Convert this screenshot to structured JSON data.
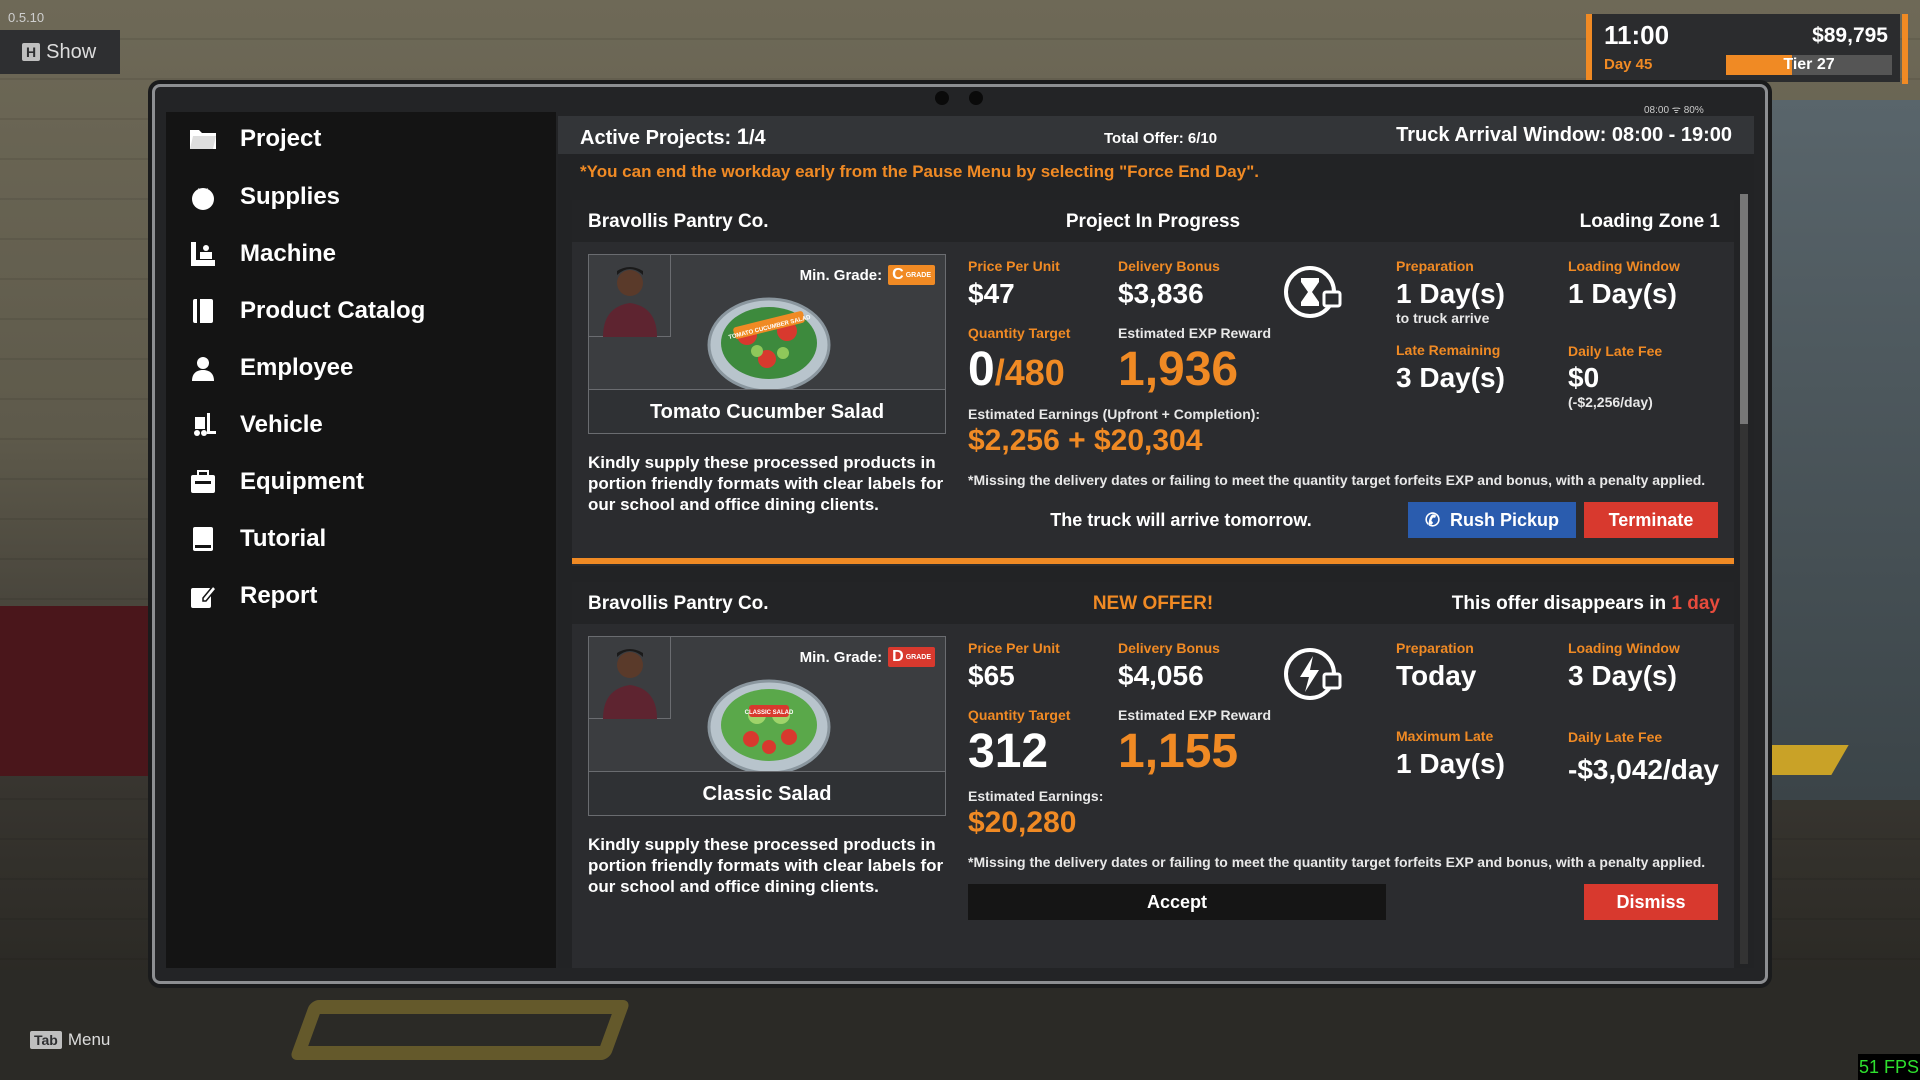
{
  "game": {
    "version": "0.5.10",
    "show_key": "H",
    "show_label": "Show",
    "menu_key": "Tab",
    "menu_label": "Menu",
    "fps": "51 FPS"
  },
  "hud": {
    "time": "11:00",
    "money": "$89,795",
    "day": "Day 45",
    "tier": "Tier 27",
    "tier_progress": 0.4
  },
  "tablet_status": "08:00  ᯤ  80%",
  "sidebar": {
    "items": [
      {
        "label": "Project",
        "icon": "folder-icon"
      },
      {
        "label": "Supplies",
        "icon": "tomato-icon"
      },
      {
        "label": "Machine",
        "icon": "machine-icon"
      },
      {
        "label": "Product Catalog",
        "icon": "catalog-icon"
      },
      {
        "label": "Employee",
        "icon": "employee-icon"
      },
      {
        "label": "Vehicle",
        "icon": "forklift-icon"
      },
      {
        "label": "Equipment",
        "icon": "equipment-icon"
      },
      {
        "label": "Tutorial",
        "icon": "book-icon"
      },
      {
        "label": "Report",
        "icon": "report-icon"
      }
    ]
  },
  "header": {
    "active_label": "Active Projects:",
    "active_value": "1",
    "active_total": "/4",
    "total_offer": "Total Offer: 6/10",
    "truck_window": "Truck Arrival Window: 08:00 - 19:00",
    "notice": "*You can end the workday early from the Pause Menu by selecting \"Force End Day\"."
  },
  "project": {
    "company": "Bravollis Pantry Co.",
    "status": "Project In Progress",
    "zone": "Loading Zone 1",
    "min_grade_label": "Min. Grade:",
    "grade": "C",
    "grade_word": "GRADE",
    "plate_text": "TOMATO CUCUMBER SALAD",
    "product": "Tomato Cucumber Salad",
    "description": "Kindly supply these processed products in portion friendly formats with clear labels for our school and office dining clients.",
    "price_label": "Price Per Unit",
    "price": "$47",
    "bonus_label": "Delivery Bonus",
    "bonus": "$3,836",
    "qty_label": "Quantity Target",
    "qty_done": "0",
    "qty_target": "/480",
    "exp_label": "Estimated EXP Reward",
    "exp": "1,936",
    "prep_label": "Preparation",
    "prep": "1 Day(s)",
    "prep_sub": "to truck arrive",
    "loading_label": "Loading Window",
    "loading": "1 Day(s)",
    "late_label": "Late Remaining",
    "late": "3 Day(s)",
    "fee_label": "Daily Late Fee",
    "fee": "$0",
    "fee_sub": "(-$2,256/day)",
    "earn_label": "Estimated Earnings (Upfront + Completion):",
    "earn": "$2,256 + $20,304",
    "warning": "*Missing the delivery dates or failing to meet the quantity target forfeits EXP and bonus, with a penalty applied.",
    "truck_msg": "The truck will arrive tomorrow.",
    "rush": "Rush Pickup",
    "terminate": "Terminate"
  },
  "offer": {
    "company": "Bravollis Pantry Co.",
    "status": "NEW OFFER!",
    "expires_prefix": "This offer disappears in",
    "expires": "1 day",
    "min_grade_label": "Min. Grade:",
    "grade": "D",
    "grade_word": "GRADE",
    "plate_text": "CLASSIC SALAD",
    "product": "Classic Salad",
    "description": "Kindly supply these processed products in portion friendly formats with clear labels for our school and office dining clients.",
    "price_label": "Price Per Unit",
    "price": "$65",
    "bonus_label": "Delivery Bonus",
    "bonus": "$4,056",
    "qty_label": "Quantity Target",
    "qty": "312",
    "exp_label": "Estimated EXP Reward",
    "exp": "1,155",
    "prep_label": "Preparation",
    "prep": "Today",
    "loading_label": "Loading Window",
    "loading": "3 Day(s)",
    "max_late_label": "Maximum Late",
    "max_late": "1 Day(s)",
    "fee_label": "Daily Late Fee",
    "fee": "-$3,042/day",
    "earn_label": "Estimated Earnings:",
    "earn": "$20,280",
    "warning": "*Missing the delivery dates or failing to meet the quantity target forfeits EXP and bonus, with a penalty applied.",
    "accept": "Accept",
    "dismiss": "Dismiss"
  }
}
